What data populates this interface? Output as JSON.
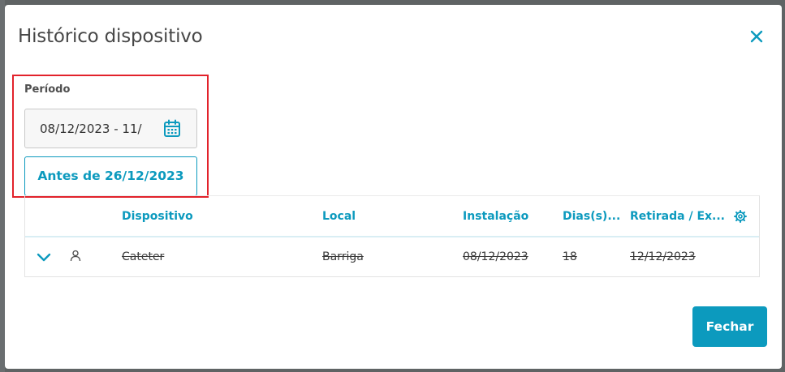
{
  "modal": {
    "title": "Histórico dispositivo",
    "close_icon": "close-icon"
  },
  "filter": {
    "periodo_label": "Período",
    "date_range_value": "08/12/2023 - 11/",
    "calendar_icon": "calendar-icon",
    "antes_button_label": "Antes de 26/12/2023"
  },
  "table": {
    "columns": [
      "Dispositivo",
      "Local",
      "Instalação",
      "Dias(s)...",
      "Retirada / Ex..."
    ],
    "settings_icon": "gear-icon",
    "rows": [
      {
        "expand_icon": "chevron-down-icon",
        "user_icon": "person-icon",
        "dispositivo": "Cateter",
        "local": "Barriga",
        "instalacao": "08/12/2023",
        "dias": "18",
        "retirada": "12/12/2023",
        "removed": true
      }
    ]
  },
  "footer": {
    "fechar_label": "Fechar"
  },
  "colors": {
    "accent": "#0c9abe",
    "highlight": "#e2222b",
    "backdrop": "#5f6364"
  }
}
